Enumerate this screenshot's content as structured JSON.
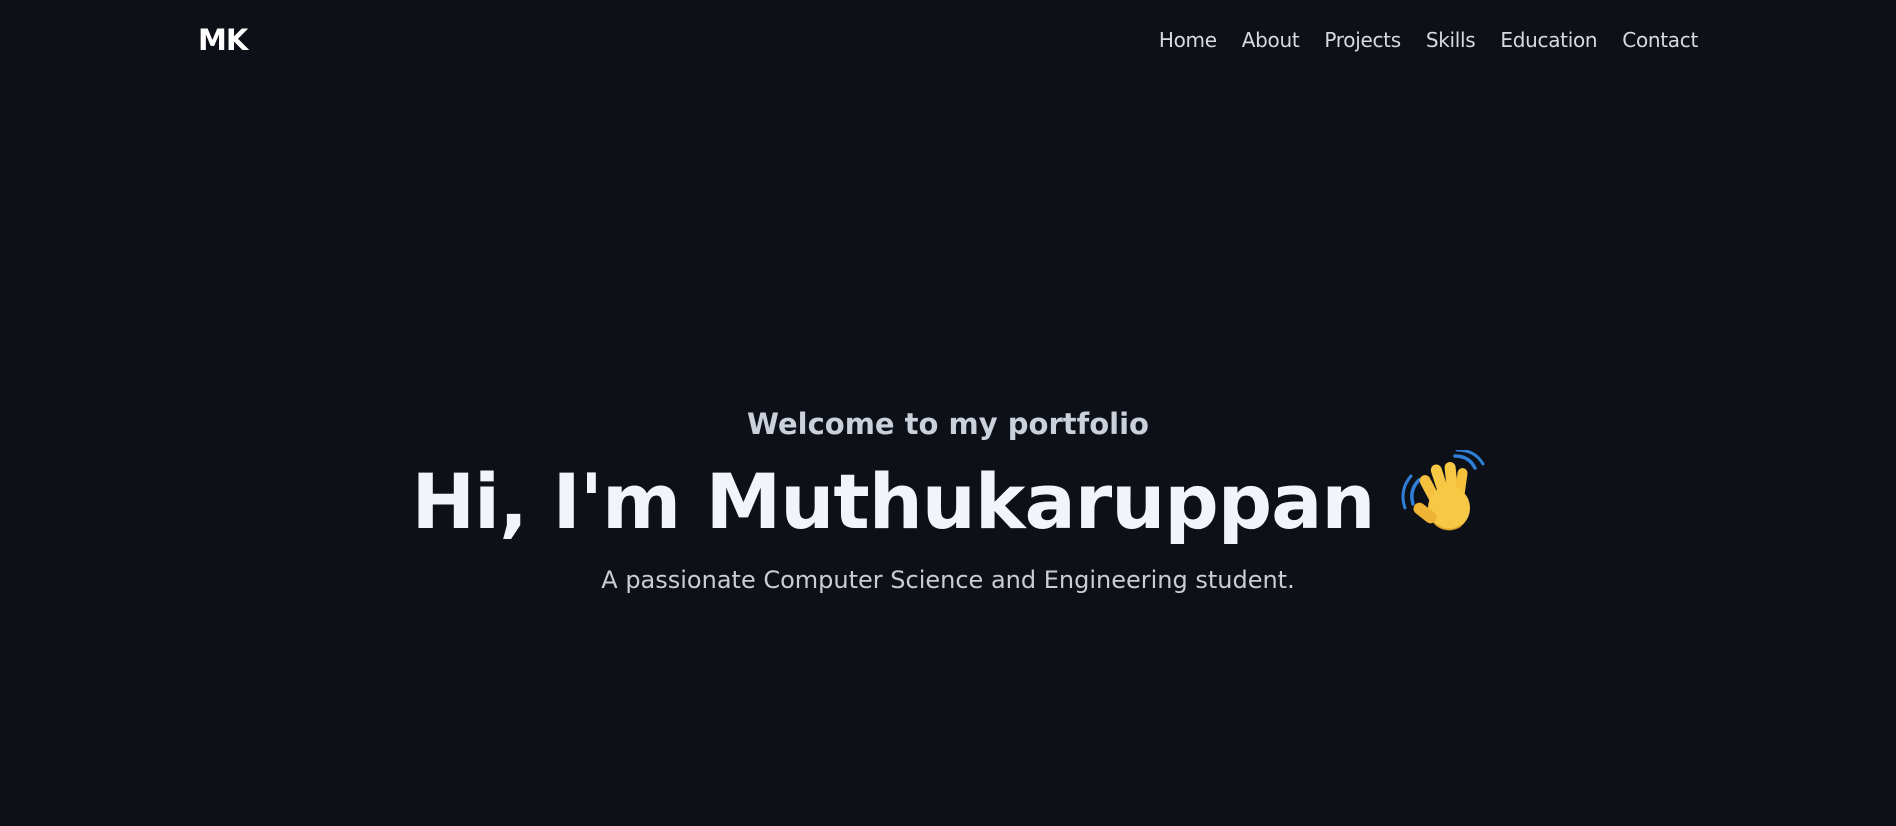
{
  "nav": {
    "logo": "MK",
    "links": [
      "Home",
      "About",
      "Projects",
      "Skills",
      "Education",
      "Contact"
    ]
  },
  "hero": {
    "eyebrow": "Welcome to my portfolio",
    "headline": "Hi, I'm Muthukaruppan",
    "wave_icon": "waving-hand-emoji",
    "tagline": "A passionate Computer Science and Engineering student."
  },
  "colors": {
    "background": "#0d1017",
    "headline": "#f1f4f8",
    "nav_text": "#d6dae2",
    "wave_hand": "#f5c13d",
    "wave_lines": "#2f7fd6"
  }
}
